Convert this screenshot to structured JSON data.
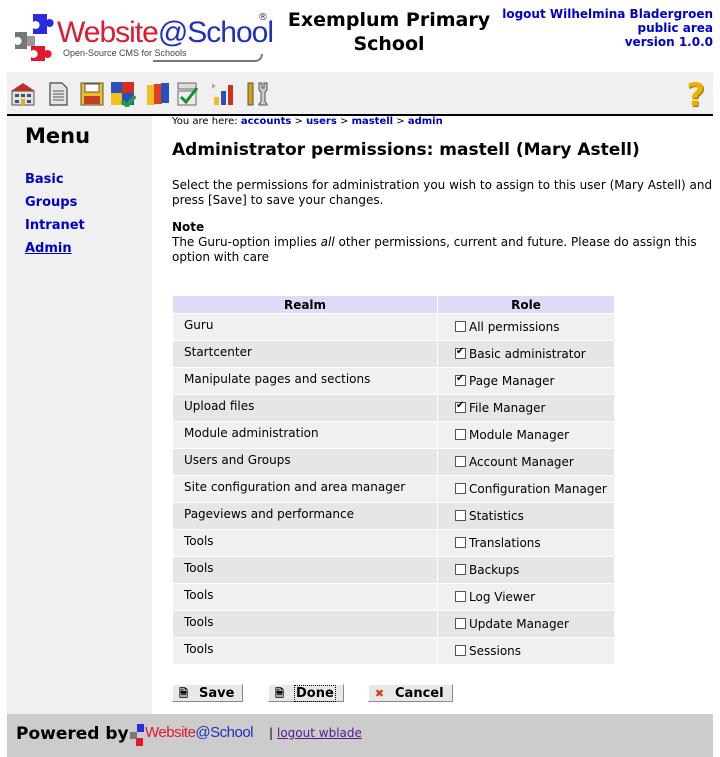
{
  "header": {
    "logo": {
      "word_red": "Website",
      "word_blue": "@School",
      "registered": "®",
      "tagline": "Open-Source CMS for Schools"
    },
    "site_title_line1": "Exemplum Primary",
    "site_title_line2": "School",
    "user_logout": "logout Wilhelmina Bladergroen",
    "area": "public area",
    "version": "version 1.0.0"
  },
  "toolbar": {
    "icons": [
      "home-icon",
      "page-icon",
      "save-disk-icon",
      "modules-puzzle-icon",
      "faces-accounts-icon",
      "checklist-config-icon",
      "statistics-bar-icon",
      "tools-icon"
    ],
    "help_glyph": "?"
  },
  "sidebar": {
    "title": "Menu",
    "items": [
      {
        "label": "Basic",
        "active": false
      },
      {
        "label": "Groups",
        "active": false
      },
      {
        "label": "Intranet",
        "active": false
      },
      {
        "label": "Admin",
        "active": true
      }
    ]
  },
  "breadcrumb": {
    "prefix": "You are here: ",
    "items": [
      "accounts",
      "users",
      "mastell",
      "admin"
    ],
    "separator": " > "
  },
  "main": {
    "heading": "Administrator permissions: mastell (Mary Astell)",
    "intro": "Select the permissions for administration you wish to assign to this user (Mary Astell) and press [Save] to save your changes.",
    "note_title": "Note",
    "note_before": "The Guru-option implies ",
    "note_em": "all",
    "note_after": " other permissions, current and future. Please do assign this option with care"
  },
  "table": {
    "headers": [
      "Realm",
      "Role"
    ],
    "rows": [
      {
        "realm": "Guru",
        "role": "All permissions",
        "checked": false
      },
      {
        "realm": "Startcenter",
        "role": "Basic administrator",
        "checked": true
      },
      {
        "realm": "Manipulate pages and sections",
        "role": "Page Manager",
        "checked": true
      },
      {
        "realm": "Upload files",
        "role": "File Manager",
        "checked": true
      },
      {
        "realm": "Module administration",
        "role": "Module Manager",
        "checked": false
      },
      {
        "realm": "Users and Groups",
        "role": "Account Manager",
        "checked": false
      },
      {
        "realm": "Site configuration and area manager",
        "role": "Configuration Manager",
        "checked": false
      },
      {
        "realm": "Pageviews and performance",
        "role": "Statistics",
        "checked": false
      },
      {
        "realm": "Tools",
        "role": "Translations",
        "checked": false
      },
      {
        "realm": "Tools",
        "role": "Backups",
        "checked": false
      },
      {
        "realm": "Tools",
        "role": "Log Viewer",
        "checked": false
      },
      {
        "realm": "Tools",
        "role": "Update Manager",
        "checked": false
      },
      {
        "realm": "Tools",
        "role": "Sessions",
        "checked": false
      }
    ]
  },
  "buttons": {
    "save": "Save",
    "done": "Done",
    "cancel": "Cancel"
  },
  "footer": {
    "powered_by": "Powered by",
    "logo_text_red": "Website",
    "logo_text_blue": "@School",
    "separator": "|",
    "logout": "logout wblade"
  },
  "colors": {
    "link": "#0000cc",
    "table_header": "#dcdcf8",
    "sidebar_bg": "#f0f0f0",
    "footer_bg": "#cccccc",
    "logo_red": "#e01830",
    "logo_blue": "#2030c0"
  }
}
